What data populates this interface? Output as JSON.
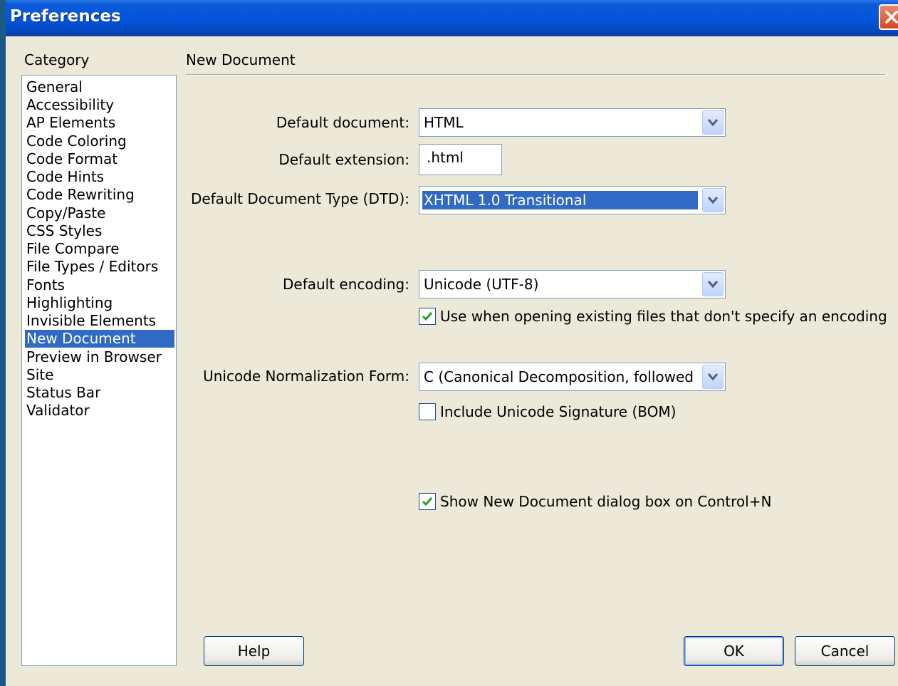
{
  "window": {
    "title": "Preferences"
  },
  "category": {
    "label": "Category",
    "items": [
      {
        "label": "General"
      },
      {
        "label": "Accessibility"
      },
      {
        "label": "AP Elements"
      },
      {
        "label": "Code Coloring"
      },
      {
        "label": "Code Format"
      },
      {
        "label": "Code Hints"
      },
      {
        "label": "Code Rewriting"
      },
      {
        "label": "Copy/Paste"
      },
      {
        "label": "CSS Styles"
      },
      {
        "label": "File Compare"
      },
      {
        "label": "File Types / Editors"
      },
      {
        "label": "Fonts"
      },
      {
        "label": "Highlighting"
      },
      {
        "label": "Invisible Elements"
      },
      {
        "label": "New Document"
      },
      {
        "label": "Preview in Browser"
      },
      {
        "label": "Site"
      },
      {
        "label": "Status Bar"
      },
      {
        "label": "Validator"
      }
    ],
    "selected": "New Document"
  },
  "panel": {
    "title": "New Document",
    "default_document": {
      "label": "Default document:",
      "value": "HTML"
    },
    "default_extension": {
      "label": "Default extension:",
      "value": ".html"
    },
    "dtd": {
      "label": "Default Document Type (DTD):",
      "value": "XHTML 1.0 Transitional"
    },
    "encoding": {
      "label": "Default encoding:",
      "value": "Unicode (UTF-8)"
    },
    "use_encoding": {
      "label": "Use when opening existing files that don't specify an encoding",
      "checked": true
    },
    "normalization": {
      "label": "Unicode Normalization Form:",
      "value": "C (Canonical Decomposition, followed by Canonical Composition)"
    },
    "bom": {
      "label": "Include Unicode Signature (BOM)",
      "checked": false
    },
    "show_dialog": {
      "label": "Show New Document dialog box on Control+N",
      "checked": true
    }
  },
  "buttons": {
    "help": "Help",
    "ok": "OK",
    "cancel": "Cancel"
  },
  "colors": {
    "selection": "#316ac5",
    "titlebar": "#0455dc",
    "dialog_bg": "#ece9d8"
  }
}
